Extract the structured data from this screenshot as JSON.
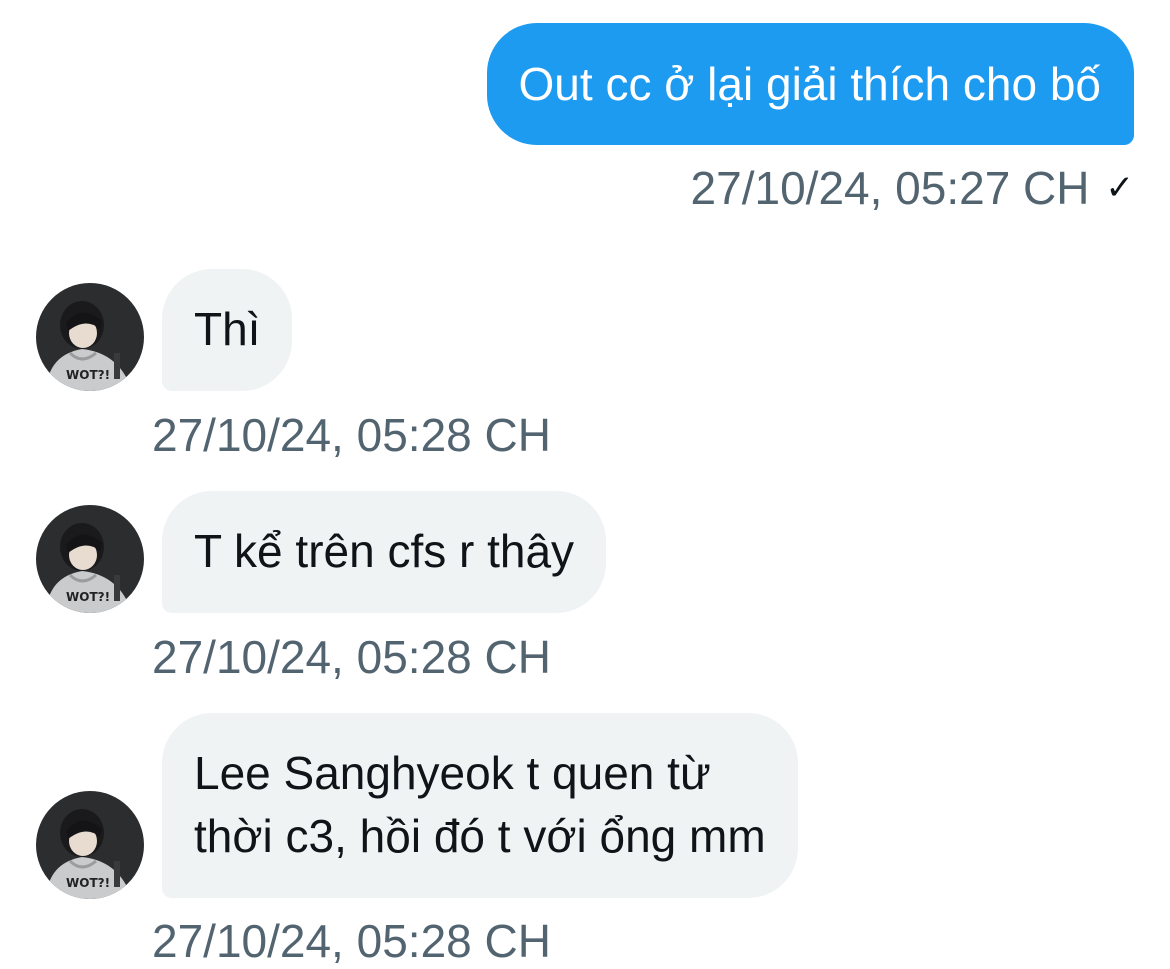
{
  "outgoing": {
    "text": "Out cc ở lại giải thích cho bố",
    "timestamp": "27/10/24, 05:27 CH",
    "status_icon": "checkmark-icon"
  },
  "incoming": [
    {
      "text": "Thì",
      "timestamp": "27/10/24, 05:28 CH"
    },
    {
      "text": "T kể trên cfs r thây",
      "timestamp": "27/10/24, 05:28 CH"
    },
    {
      "text": "Lee Sanghyeok t quen từ\nthời c3, hồi đó t với ổng mm",
      "timestamp": "27/10/24, 05:28 CH"
    }
  ],
  "colors": {
    "outgoing_bubble": "#1d9bf0",
    "incoming_bubble": "#eff3f4",
    "timestamp": "#536471"
  }
}
